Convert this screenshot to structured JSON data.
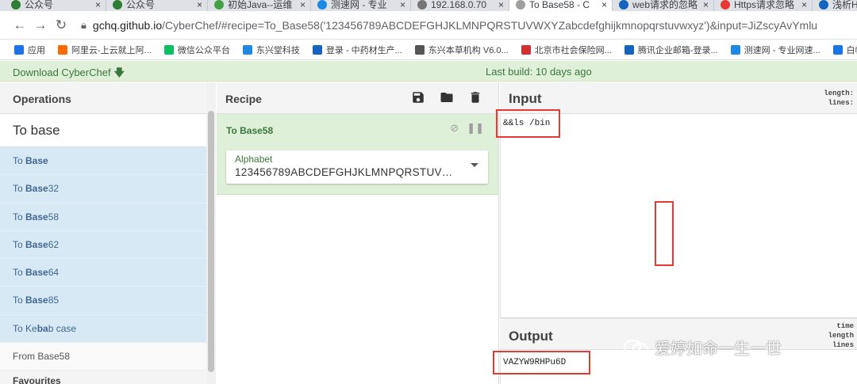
{
  "browser": {
    "tabs": [
      {
        "label": "公众号",
        "color": "#2e7d32",
        "active": false
      },
      {
        "label": "公众号",
        "color": "#2e7d32",
        "active": false
      },
      {
        "label": "初始Java--运维",
        "color": "#43a047",
        "active": false
      },
      {
        "label": "测速网 - 专业",
        "color": "#1e88e5",
        "active": false
      },
      {
        "label": "192.168.0.70",
        "color": "#757575",
        "active": false
      },
      {
        "label": "To Base58 - C",
        "color": "#9e9e9e",
        "active": true
      },
      {
        "label": "web请求的忽略",
        "color": "#1565c0",
        "active": false
      },
      {
        "label": "Https请求忽略",
        "color": "#e53935",
        "active": false
      },
      {
        "label": "浅析HTT",
        "color": "#1565c0",
        "active": false
      }
    ],
    "url_host": "gchq.github.io",
    "url_path": "/CyberChef/#recipe=To_Base58('123456789ABCDEFGHJKLMNPQRSTUVWXYZabcdefghijkmnopqrstuvwxyz')&input=JiZscyAvYmlu",
    "bookmarks": [
      {
        "label": "应用",
        "color": "#1a73e8"
      },
      {
        "label": "阿里云-上云就上阿...",
        "color": "#ff6a00"
      },
      {
        "label": "微信公众平台",
        "color": "#07c160"
      },
      {
        "label": "东兴堂科技",
        "color": "#1e88e5"
      },
      {
        "label": "登录 - 中药材生产...",
        "color": "#1565c0"
      },
      {
        "label": "东兴本草机构 V6.0...",
        "color": "#555555"
      },
      {
        "label": "北京市社会保险网...",
        "color": "#d32f2f"
      },
      {
        "label": "腾讯企业邮箱-登录...",
        "color": "#1565c0"
      },
      {
        "label": "测速网 - 专业网速...",
        "color": "#1e88e5"
      },
      {
        "label": "白帽学",
        "color": "#1a73e8"
      }
    ]
  },
  "banner": {
    "download_label": "Download CyberChef",
    "last_build": "Last build: 10 days ago"
  },
  "operations": {
    "header": "Operations",
    "search_value": "To base",
    "items": [
      {
        "prefix": "To ",
        "bold": "Base",
        "suffix": ""
      },
      {
        "prefix": "To ",
        "bold": "Base",
        "suffix": "32"
      },
      {
        "prefix": "To ",
        "bold": "Base",
        "suffix": "58"
      },
      {
        "prefix": "To ",
        "bold": "Base",
        "suffix": "62"
      },
      {
        "prefix": "To ",
        "bold": "Base",
        "suffix": "64"
      },
      {
        "prefix": "To ",
        "bold": "Base",
        "suffix": "85"
      },
      {
        "prefix": "To Ke",
        "bold": "ba",
        "suffix": "b case"
      }
    ],
    "plain_item": "From Base58",
    "favourites": "Favourites"
  },
  "recipe": {
    "header": "Recipe",
    "operation_title": "To Base58",
    "alphabet_label": "Alphabet",
    "alphabet_value": "123456789ABCDEFGHJKLMNPQRSTUVWXYZabcdefghijkmnopqrstuvwxyz"
  },
  "input": {
    "header": "Input",
    "stats": [
      "length:",
      "lines:"
    ],
    "value": "&&ls /bin"
  },
  "output": {
    "header": "Output",
    "stats": [
      "time",
      "length",
      "lines"
    ],
    "value": "VAZYW9RHPu6D"
  },
  "watermark": "爱婷如命一生一世"
}
